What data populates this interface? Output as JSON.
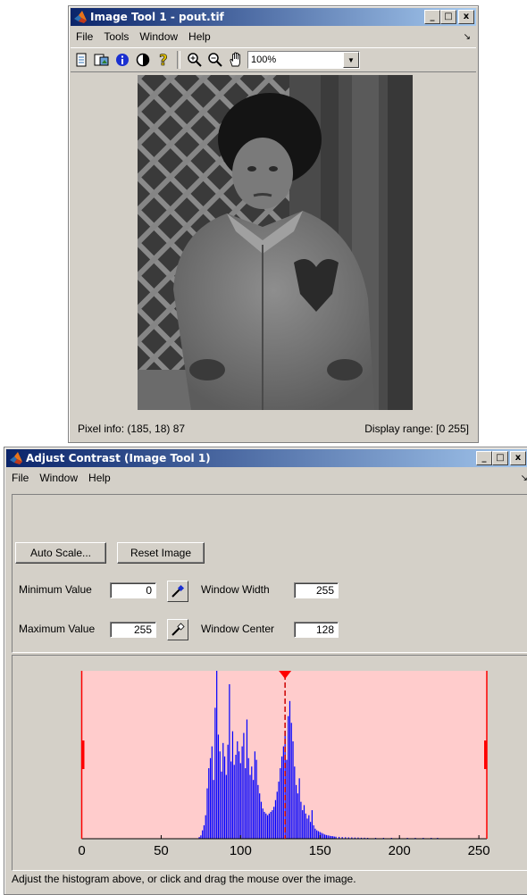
{
  "image_tool": {
    "title": "Image Tool 1 - pout.tif",
    "menu": [
      "File",
      "Tools",
      "Window",
      "Help"
    ],
    "dock_glyph": "↘",
    "toolbar_icons": [
      "new-figure-icon",
      "export-icon",
      "image-info-icon",
      "adjust-contrast-icon",
      "help-icon",
      "zoom-in-icon",
      "zoom-out-icon",
      "pan-hand-icon"
    ],
    "zoom_value": "100%",
    "pixel_info": "Pixel info: (185, 18)  87",
    "display_range": "Display range: [0 255]"
  },
  "adjust_contrast": {
    "title": "Adjust Contrast (Image Tool 1)",
    "menu": [
      "File",
      "Window",
      "Help"
    ],
    "dock_glyph": "↘",
    "auto_scale_label": "Auto Scale...",
    "reset_image_label": "Reset Image",
    "min_label": "Minimum Value",
    "min_value": "0",
    "max_label": "Maximum Value",
    "max_value": "255",
    "width_label": "Window Width",
    "width_value": "255",
    "center_label": "Window Center",
    "center_value": "128",
    "status_text": "Adjust the histogram above, or click and drag the mouse over the image."
  },
  "window_buttons": {
    "minimize": "_",
    "maximize": "□",
    "close": "x"
  },
  "colors": {
    "title_active": "#0a246a",
    "histogram_bg": "#ffcccc",
    "histogram_bars": "#0000ff",
    "limit_markers": "#ff0000"
  },
  "chart_data": {
    "type": "bar",
    "xlim": [
      0,
      255
    ],
    "ticks": [
      0,
      50,
      100,
      150,
      200,
      250
    ],
    "min_marker": 0,
    "max_marker": 255,
    "center_marker": 128,
    "bins": [
      {
        "x": 74,
        "v": 0.01
      },
      {
        "x": 75,
        "v": 0.02
      },
      {
        "x": 76,
        "v": 0.05
      },
      {
        "x": 77,
        "v": 0.08
      },
      {
        "x": 78,
        "v": 0.14
      },
      {
        "x": 79,
        "v": 0.3
      },
      {
        "x": 80,
        "v": 0.42
      },
      {
        "x": 81,
        "v": 0.48
      },
      {
        "x": 82,
        "v": 0.55
      },
      {
        "x": 83,
        "v": 0.35
      },
      {
        "x": 84,
        "v": 0.78
      },
      {
        "x": 85,
        "v": 1.0
      },
      {
        "x": 86,
        "v": 0.62
      },
      {
        "x": 87,
        "v": 0.52
      },
      {
        "x": 88,
        "v": 0.4
      },
      {
        "x": 89,
        "v": 0.57
      },
      {
        "x": 90,
        "v": 0.49
      },
      {
        "x": 91,
        "v": 0.38
      },
      {
        "x": 92,
        "v": 0.56
      },
      {
        "x": 93,
        "v": 0.92
      },
      {
        "x": 94,
        "v": 0.46
      },
      {
        "x": 95,
        "v": 0.64
      },
      {
        "x": 96,
        "v": 0.44
      },
      {
        "x": 97,
        "v": 0.5
      },
      {
        "x": 98,
        "v": 0.58
      },
      {
        "x": 99,
        "v": 0.52
      },
      {
        "x": 100,
        "v": 0.45
      },
      {
        "x": 101,
        "v": 0.55
      },
      {
        "x": 102,
        "v": 0.63
      },
      {
        "x": 103,
        "v": 0.42
      },
      {
        "x": 104,
        "v": 0.71
      },
      {
        "x": 105,
        "v": 0.48
      },
      {
        "x": 106,
        "v": 0.38
      },
      {
        "x": 107,
        "v": 0.43
      },
      {
        "x": 108,
        "v": 0.35
      },
      {
        "x": 109,
        "v": 0.52
      },
      {
        "x": 110,
        "v": 0.47
      },
      {
        "x": 111,
        "v": 0.32
      },
      {
        "x": 112,
        "v": 0.27
      },
      {
        "x": 113,
        "v": 0.22
      },
      {
        "x": 114,
        "v": 0.18
      },
      {
        "x": 115,
        "v": 0.16
      },
      {
        "x": 116,
        "v": 0.15
      },
      {
        "x": 117,
        "v": 0.14
      },
      {
        "x": 118,
        "v": 0.15
      },
      {
        "x": 119,
        "v": 0.16
      },
      {
        "x": 120,
        "v": 0.17
      },
      {
        "x": 121,
        "v": 0.19
      },
      {
        "x": 122,
        "v": 0.23
      },
      {
        "x": 123,
        "v": 0.28
      },
      {
        "x": 124,
        "v": 0.34
      },
      {
        "x": 125,
        "v": 0.42
      },
      {
        "x": 126,
        "v": 0.49
      },
      {
        "x": 127,
        "v": 0.55
      },
      {
        "x": 128,
        "v": 0.64
      },
      {
        "x": 129,
        "v": 0.47
      },
      {
        "x": 130,
        "v": 0.73
      },
      {
        "x": 131,
        "v": 0.82
      },
      {
        "x": 132,
        "v": 0.69
      },
      {
        "x": 133,
        "v": 0.58
      },
      {
        "x": 134,
        "v": 0.43
      },
      {
        "x": 135,
        "v": 0.32
      },
      {
        "x": 136,
        "v": 0.27
      },
      {
        "x": 137,
        "v": 0.36
      },
      {
        "x": 138,
        "v": 0.22
      },
      {
        "x": 139,
        "v": 0.17
      },
      {
        "x": 140,
        "v": 0.2
      },
      {
        "x": 141,
        "v": 0.15
      },
      {
        "x": 142,
        "v": 0.12
      },
      {
        "x": 143,
        "v": 0.14
      },
      {
        "x": 144,
        "v": 0.1
      },
      {
        "x": 145,
        "v": 0.17
      },
      {
        "x": 146,
        "v": 0.08
      },
      {
        "x": 147,
        "v": 0.06
      },
      {
        "x": 148,
        "v": 0.05
      },
      {
        "x": 149,
        "v": 0.045
      },
      {
        "x": 150,
        "v": 0.04
      },
      {
        "x": 151,
        "v": 0.035
      },
      {
        "x": 152,
        "v": 0.03
      },
      {
        "x": 153,
        "v": 0.025
      },
      {
        "x": 154,
        "v": 0.022
      },
      {
        "x": 155,
        "v": 0.02
      },
      {
        "x": 156,
        "v": 0.018
      },
      {
        "x": 157,
        "v": 0.016
      },
      {
        "x": 158,
        "v": 0.015
      },
      {
        "x": 159,
        "v": 0.013
      },
      {
        "x": 160,
        "v": 0.012
      },
      {
        "x": 162,
        "v": 0.011
      },
      {
        "x": 164,
        "v": 0.01
      },
      {
        "x": 166,
        "v": 0.009
      },
      {
        "x": 168,
        "v": 0.008
      },
      {
        "x": 170,
        "v": 0.008
      },
      {
        "x": 172,
        "v": 0.007
      },
      {
        "x": 174,
        "v": 0.007
      },
      {
        "x": 176,
        "v": 0.006
      },
      {
        "x": 178,
        "v": 0.006
      },
      {
        "x": 180,
        "v": 0.005
      },
      {
        "x": 185,
        "v": 0.005
      },
      {
        "x": 190,
        "v": 0.004
      },
      {
        "x": 195,
        "v": 0.004
      },
      {
        "x": 200,
        "v": 0.004
      },
      {
        "x": 205,
        "v": 0.003
      },
      {
        "x": 210,
        "v": 0.003
      },
      {
        "x": 215,
        "v": 0.003
      },
      {
        "x": 220,
        "v": 0.002
      },
      {
        "x": 224,
        "v": 0.002
      }
    ]
  }
}
